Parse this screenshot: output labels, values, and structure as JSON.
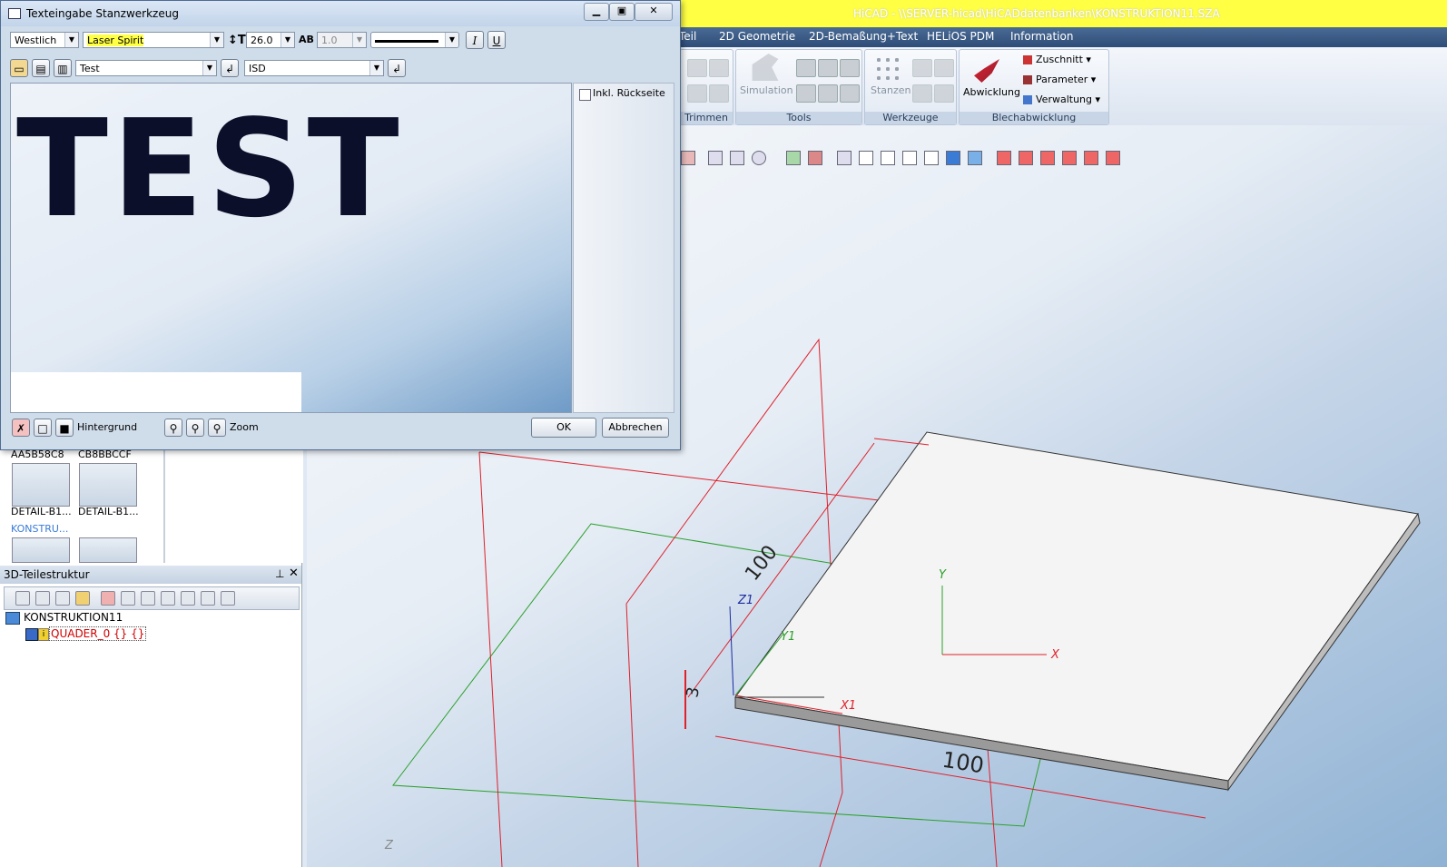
{
  "app_title": "HiCAD - \\\\SERVER-hicad\\HiCADdatenbanken\\KONSTRUKTION11.SZA",
  "menu": [
    "Teil",
    "2D Geometrie",
    "2D-Bemaßung+Text",
    "HELiOS PDM",
    "Information"
  ],
  "ribbon": {
    "groups": [
      "Trimmen",
      "Tools",
      "Werkzeuge",
      "Blechabwicklung"
    ],
    "simulation_label": "Simulation",
    "stanzen_label": "Stanzen",
    "abwicklung_label": "Abwicklung",
    "zuschnitt_label": "Zuschnitt",
    "parameter_label": "Parameter",
    "verwaltung_label": "Verwaltung"
  },
  "dialog": {
    "title": "Texteingabe Stanzwerkzeug",
    "script": "Westlich",
    "font": "Laser Spirit",
    "size": "26.0",
    "spacing": "1.0",
    "text_value": "Test",
    "standard": "ISD",
    "preview_text": "TEST",
    "include_back": "Inkl. Rückseite",
    "background_label": "Hintergrund",
    "zoom_label": "Zoom",
    "ok": "OK",
    "cancel": "Abbrechen"
  },
  "thumbnails": [
    {
      "top_label": "AA5B58C8",
      "bottom_label": "DETAIL-B1..."
    },
    {
      "top_label": "CB8BBCCF",
      "bottom_label": "DETAIL-B1..."
    }
  ],
  "thumb_folder": "KONSTRU...",
  "tree": {
    "header": "3D-Teilestruktur",
    "root": "KONSTRUKTION11",
    "child": "QUADER_0 {} {}"
  },
  "viewport_labels": {
    "dim_top": "100",
    "dim_bottom": "100",
    "dim_thickness": "3",
    "z1": "Z1",
    "y1": "Y1",
    "x1": "X1",
    "x": "X",
    "y": "Y",
    "z": "Z"
  },
  "colors": {
    "title_highlight": "#ffff44",
    "menu_bg": "#3a5a86",
    "red_plane": "#e0202a",
    "green_plane": "#2aa02a",
    "tree_red": "#d00000"
  }
}
